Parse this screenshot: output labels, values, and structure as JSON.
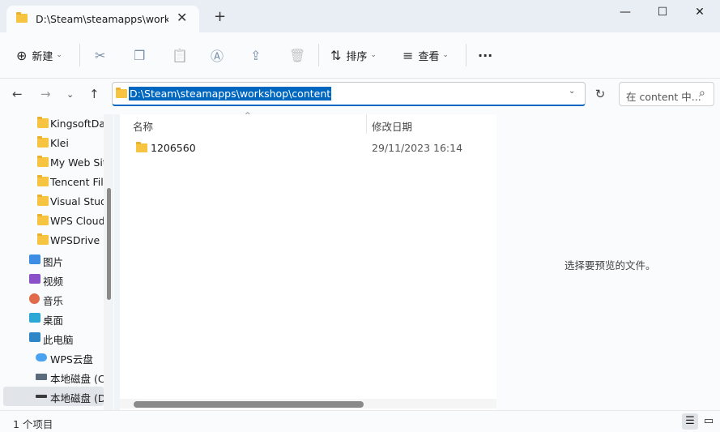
{
  "tab": {
    "title": "D:\\Steam\\steamapps\\worksho",
    "close": "✕",
    "new_tab": "+"
  },
  "window": {
    "minimize": "—",
    "maximize": "☐",
    "close": "✕"
  },
  "toolbar": {
    "new_icon": "⊕",
    "new_label": "新建",
    "cut_icon": "✂",
    "copy_icon": "❐",
    "paste_icon": "📋",
    "rename_icon": "Ⓐ",
    "share_icon": "⇪",
    "delete_icon": "🗑",
    "sort_icon": "⇅",
    "sort_label": "排序",
    "view_icon": "≡",
    "view_label": "查看",
    "more": "···",
    "caret": "⌄"
  },
  "nav": {
    "back": "←",
    "forward": "→",
    "recent": "⌄",
    "up": "↑",
    "refresh": "↻"
  },
  "address": {
    "path": "D:\\Steam\\steamapps\\workshop\\content",
    "chevron": "⌄"
  },
  "search": {
    "placeholder": "在 content 中...",
    "icon": "⌕"
  },
  "sidebar": {
    "items": [
      {
        "label": "KingsoftData",
        "icon": "folder-icon"
      },
      {
        "label": "Klei",
        "icon": "folder-icon"
      },
      {
        "label": "My Web Sites",
        "icon": "folder-icon"
      },
      {
        "label": "Tencent Files",
        "icon": "folder-icon"
      },
      {
        "label": "Visual Studio",
        "icon": "folder-icon"
      },
      {
        "label": "WPS Cloud",
        "icon": "folder-icon"
      },
      {
        "label": "WPSDrive",
        "icon": "folder-icon"
      },
      {
        "label": "图片",
        "icon": "pictures-icon"
      },
      {
        "label": "视频",
        "icon": "videos-icon"
      },
      {
        "label": "音乐",
        "icon": "music-icon"
      },
      {
        "label": "桌面",
        "icon": "desktop-icon"
      },
      {
        "label": "此电脑",
        "icon": "computer-icon"
      },
      {
        "label": "WPS云盘",
        "icon": "cloud-icon"
      },
      {
        "label": "本地磁盘 (C:)",
        "icon": "drive-icon"
      },
      {
        "label": "本地磁盘 (D:)",
        "icon": "drive-icon"
      }
    ]
  },
  "columns": {
    "name": "名称",
    "modified": "修改日期",
    "sort_arrow": "^"
  },
  "files": [
    {
      "name": "1206560",
      "modified": "29/11/2023 16:14"
    }
  ],
  "preview": {
    "message": "选择要预览的文件。"
  },
  "status": {
    "count": "1 个项目",
    "details_icon": "☰",
    "tiles_icon": "▭"
  },
  "colors": {
    "accent": "#0067c0",
    "folder": "#f7c441"
  }
}
